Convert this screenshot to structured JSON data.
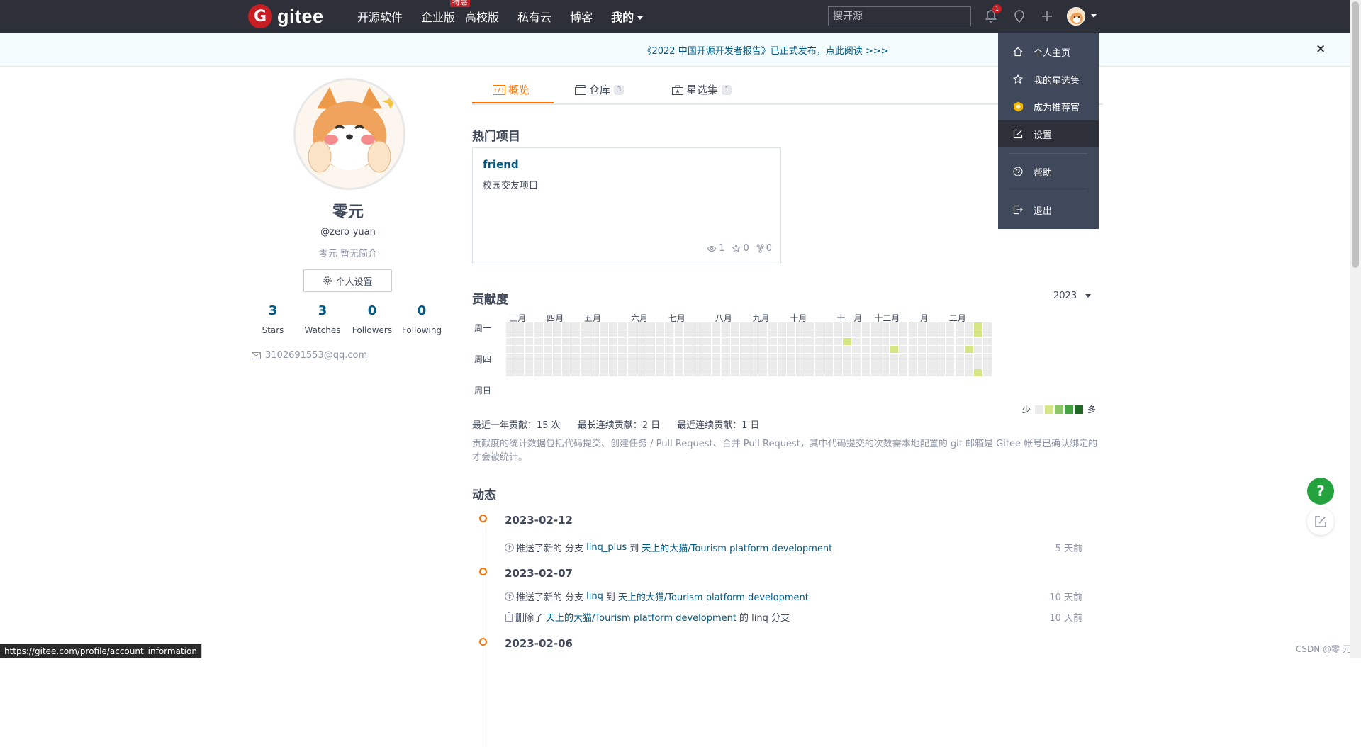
{
  "topbar": {
    "logo_mark": "G",
    "logo_text": "gitee",
    "nav": [
      {
        "label": "开源软件"
      },
      {
        "label": "企业版",
        "badge": "特惠"
      },
      {
        "label": "高校版"
      },
      {
        "label": "私有云"
      },
      {
        "label": "博客"
      },
      {
        "label": "我的"
      }
    ],
    "search_placeholder": "搜开源",
    "notification_count": "1"
  },
  "announcement": {
    "text": "《2022 中国开源开发者报告》已正式发布，点此阅读 >>>",
    "close": "×"
  },
  "profile": {
    "name": "零元",
    "handle": "@zero-yuan",
    "bio": "零元 暂无简介",
    "settings_button": "个人设置",
    "stats": [
      {
        "value": "3",
        "label": "Stars"
      },
      {
        "value": "3",
        "label": "Watches"
      },
      {
        "value": "0",
        "label": "Followers"
      },
      {
        "value": "0",
        "label": "Following"
      }
    ],
    "email": "3102691553@qq.com"
  },
  "tabs": [
    {
      "label": "概览",
      "count": ""
    },
    {
      "label": "仓库",
      "count": "3"
    },
    {
      "label": "星选集",
      "count": "1"
    }
  ],
  "hot_projects": {
    "title": "热门项目",
    "items": [
      {
        "name": "friend",
        "desc": "校园交友项目",
        "watches": "1",
        "stars": "0",
        "forks": "0"
      }
    ]
  },
  "contributions": {
    "title": "贡献度",
    "year": "2023",
    "months": [
      "三月",
      "四月",
      "五月",
      "六月",
      "七月",
      "八月",
      "九月",
      "十月",
      "十一月",
      "十二月",
      "一月",
      "二月"
    ],
    "weekdays": [
      "周一",
      "周四",
      "周日"
    ],
    "legend_less": "少",
    "legend_more": "多",
    "legend_colors": [
      "#ebebeb",
      "#d6e685",
      "#8cc665",
      "#44a340",
      "#1e6823"
    ],
    "summary": [
      "最近一年贡献：15 次",
      "最长连续贡献：2 日",
      "最近连续贡献：1 日"
    ],
    "note": "贡献度的统计数据包括代码提交、创建任务 / Pull Request、合并 Pull Request，其中代码提交的次数需本地配置的 git 邮箱是 Gitee 帐号已确认绑定的才会被统计。",
    "active_cells": [
      {
        "week": 36,
        "day": 2
      },
      {
        "week": 41,
        "day": 3
      },
      {
        "week": 49,
        "day": 3
      },
      {
        "week": 50,
        "day": 0
      },
      {
        "week": 50,
        "day": 1
      },
      {
        "week": 50,
        "day": 6
      }
    ]
  },
  "activity": {
    "title": "动态",
    "groups": [
      {
        "date": "2023-02-12",
        "events": [
          {
            "prefix": "推送了新的 分支",
            "branch": "linq_plus",
            "mid": "到",
            "repo": "天上的大猫/Tourism platform development",
            "suffix": "",
            "time": "5 天前"
          }
        ]
      },
      {
        "date": "2023-02-07",
        "events": [
          {
            "prefix": "推送了新的 分支",
            "branch": "linq",
            "mid": "到",
            "repo": "天上的大猫/Tourism platform development",
            "suffix": "",
            "time": "10 天前"
          },
          {
            "prefix": "删除了",
            "branch": "",
            "mid": "",
            "repo": "天上的大猫/Tourism platform development",
            "suffix": "的 linq 分支",
            "time": "10 天前"
          }
        ]
      },
      {
        "date": "2023-02-06",
        "events": []
      }
    ]
  },
  "dropdown": {
    "items": [
      {
        "label": "个人主页"
      },
      {
        "label": "我的星选集"
      },
      {
        "label": "成为推荐官"
      },
      {
        "label": "设置"
      },
      {
        "label": "帮助"
      },
      {
        "label": "退出"
      }
    ]
  },
  "fab": {
    "help": "?"
  },
  "statusbar": {
    "url": "https://gitee.com/profile/account_information"
  },
  "watermark": "CSDN @零 元"
}
